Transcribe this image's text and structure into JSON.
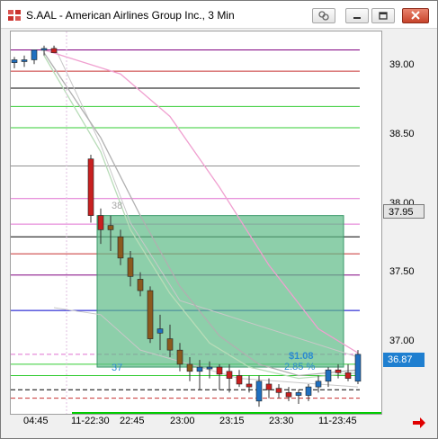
{
  "window": {
    "title": "S.AAL - American Airlines Group Inc., 3 Min",
    "buttons": [
      "link-icon",
      "minimize-icon",
      "restore-icon",
      "close-icon"
    ]
  },
  "price_axis": {
    "ticks": [
      "39.00",
      "38.50",
      "38.00",
      "37.50",
      "37.00"
    ],
    "current_price_box": "37.95",
    "last_price_box": "36.87",
    "current_box_color": "#e4e4e4",
    "last_box_color": "#1f7fd0"
  },
  "time_axis": {
    "labels": [
      "04:45",
      "11-22:30",
      "22:45",
      "23:00",
      "23:15",
      "23:30",
      "11-23:45"
    ]
  },
  "annotations": {
    "upper_level": "38",
    "lower_level": "37",
    "profit_text": "$1.08",
    "ratio_text": "2.85 %"
  },
  "colors": {
    "up_candle": "#2070c0",
    "down_candle": "#c82020",
    "dark_candle": "#8b5a1e",
    "zone_fill": "#5cba86",
    "nav_arrow": "#e00000"
  },
  "chart_data": {
    "type": "candlestick",
    "symbol": "S.AAL",
    "interval": "3 Min",
    "ylim": [
      36.55,
      39.25
    ],
    "y_ticks": [
      39.0,
      38.5,
      38.0,
      37.5,
      37.0
    ],
    "bars": [
      {
        "o": 39.03,
        "h": 39.07,
        "l": 38.99,
        "c": 39.05
      },
      {
        "o": 39.04,
        "h": 39.08,
        "l": 39.0,
        "c": 39.05
      },
      {
        "o": 39.05,
        "h": 39.12,
        "l": 39.02,
        "c": 39.12
      },
      {
        "o": 39.12,
        "h": 39.15,
        "l": 39.08,
        "c": 39.13
      },
      {
        "o": 39.13,
        "h": 39.15,
        "l": 39.1,
        "c": 39.1
      },
      {
        "o": 38.35,
        "h": 38.38,
        "l": 37.9,
        "c": 37.95
      },
      {
        "o": 37.95,
        "h": 38.0,
        "l": 37.75,
        "c": 37.85
      },
      {
        "o": 37.88,
        "h": 37.95,
        "l": 37.7,
        "c": 37.85
      },
      {
        "o": 37.8,
        "h": 37.85,
        "l": 37.6,
        "c": 37.65
      },
      {
        "o": 37.65,
        "h": 37.7,
        "l": 37.45,
        "c": 37.52
      },
      {
        "o": 37.5,
        "h": 37.55,
        "l": 37.38,
        "c": 37.42
      },
      {
        "o": 37.42,
        "h": 37.45,
        "l": 37.05,
        "c": 37.08
      },
      {
        "o": 37.12,
        "h": 37.25,
        "l": 37.0,
        "c": 37.15
      },
      {
        "o": 37.08,
        "h": 37.18,
        "l": 36.95,
        "c": 37.0
      },
      {
        "o": 37.0,
        "h": 37.05,
        "l": 36.85,
        "c": 36.9
      },
      {
        "o": 36.9,
        "h": 36.95,
        "l": 36.78,
        "c": 36.85
      },
      {
        "o": 36.85,
        "h": 36.93,
        "l": 36.72,
        "c": 36.88
      },
      {
        "o": 36.88,
        "h": 36.92,
        "l": 36.8,
        "c": 36.88
      },
      {
        "o": 36.88,
        "h": 36.9,
        "l": 36.72,
        "c": 36.83
      },
      {
        "o": 36.85,
        "h": 36.9,
        "l": 36.7,
        "c": 36.8
      },
      {
        "o": 36.82,
        "h": 36.86,
        "l": 36.74,
        "c": 36.76
      },
      {
        "o": 36.76,
        "h": 36.82,
        "l": 36.7,
        "c": 36.74
      },
      {
        "o": 36.64,
        "h": 36.82,
        "l": 36.6,
        "c": 36.78
      },
      {
        "o": 36.76,
        "h": 36.8,
        "l": 36.66,
        "c": 36.72
      },
      {
        "o": 36.73,
        "h": 36.76,
        "l": 36.66,
        "c": 36.7
      },
      {
        "o": 36.7,
        "h": 36.74,
        "l": 36.64,
        "c": 36.67
      },
      {
        "o": 36.68,
        "h": 36.72,
        "l": 36.62,
        "c": 36.7
      },
      {
        "o": 36.68,
        "h": 36.76,
        "l": 36.64,
        "c": 36.74
      },
      {
        "o": 36.74,
        "h": 36.82,
        "l": 36.7,
        "c": 36.78
      },
      {
        "o": 36.78,
        "h": 36.88,
        "l": 36.74,
        "c": 36.86
      },
      {
        "o": 36.86,
        "h": 36.9,
        "l": 36.8,
        "c": 36.84
      },
      {
        "o": 36.84,
        "h": 36.9,
        "l": 36.78,
        "c": 36.8
      },
      {
        "o": 36.78,
        "h": 37.0,
        "l": 36.76,
        "c": 36.97
      }
    ],
    "horizontal_levels": [
      {
        "price": 39.12,
        "color": "#800080",
        "style": "solid"
      },
      {
        "price": 38.97,
        "color": "#c83030",
        "style": "solid"
      },
      {
        "price": 38.85,
        "color": "#000000",
        "style": "solid"
      },
      {
        "price": 38.72,
        "color": "#33cc33",
        "style": "solid"
      },
      {
        "price": 38.57,
        "color": "#33cc33",
        "style": "solid"
      },
      {
        "price": 38.3,
        "color": "#909090",
        "style": "solid"
      },
      {
        "price": 38.07,
        "color": "#e070d0",
        "style": "solid"
      },
      {
        "price": 37.89,
        "color": "#e070d0",
        "style": "solid"
      },
      {
        "price": 37.8,
        "color": "#000000",
        "style": "solid"
      },
      {
        "price": 37.68,
        "color": "#c83030",
        "style": "solid"
      },
      {
        "price": 37.53,
        "color": "#800080",
        "style": "solid"
      },
      {
        "price": 37.28,
        "color": "#0000cc",
        "style": "solid"
      },
      {
        "price": 36.97,
        "color": "#e070d0",
        "style": "dashed"
      },
      {
        "price": 36.9,
        "color": "#33cc33",
        "style": "solid"
      },
      {
        "price": 36.82,
        "color": "#33cc33",
        "style": "solid"
      },
      {
        "price": 36.72,
        "color": "#000000",
        "style": "dashed"
      },
      {
        "price": 36.66,
        "color": "#c83030",
        "style": "dashed"
      }
    ],
    "zone": {
      "bar_from": 6,
      "bar_to": 32,
      "price_top": 37.95,
      "price_bottom": 36.88
    },
    "ma_lines": [
      {
        "color": "#f0a0d0",
        "points": [
          [
            3,
            39.12
          ],
          [
            8,
            38.95
          ],
          [
            13,
            38.65
          ],
          [
            18,
            38.15
          ],
          [
            23,
            37.6
          ],
          [
            28,
            37.15
          ],
          [
            32,
            36.98
          ]
        ]
      },
      {
        "color": "#b0b0b0",
        "points": [
          [
            3,
            39.1
          ],
          [
            6,
            38.5
          ],
          [
            10,
            37.95
          ],
          [
            14,
            37.45
          ],
          [
            18,
            37.1
          ],
          [
            22,
            36.9
          ],
          [
            26,
            36.82
          ],
          [
            32,
            36.86
          ]
        ]
      },
      {
        "color": "#b8dcb8",
        "points": [
          [
            3,
            39.08
          ],
          [
            6,
            38.4
          ],
          [
            9,
            37.85
          ],
          [
            13,
            37.4
          ],
          [
            17,
            37.05
          ],
          [
            21,
            36.88
          ],
          [
            26,
            36.8
          ],
          [
            32,
            36.84
          ]
        ]
      }
    ],
    "envelope": {
      "color": "#c8c8c8",
      "upper": [
        [
          4,
          39.15
        ],
        [
          6,
          38.45
        ],
        [
          9,
          37.9
        ],
        [
          14,
          37.35
        ],
        [
          32,
          36.95
        ]
      ],
      "lower": [
        [
          4,
          37.3
        ],
        [
          6,
          37.25
        ],
        [
          10,
          37.0
        ],
        [
          20,
          36.8
        ],
        [
          32,
          36.74
        ]
      ]
    }
  }
}
